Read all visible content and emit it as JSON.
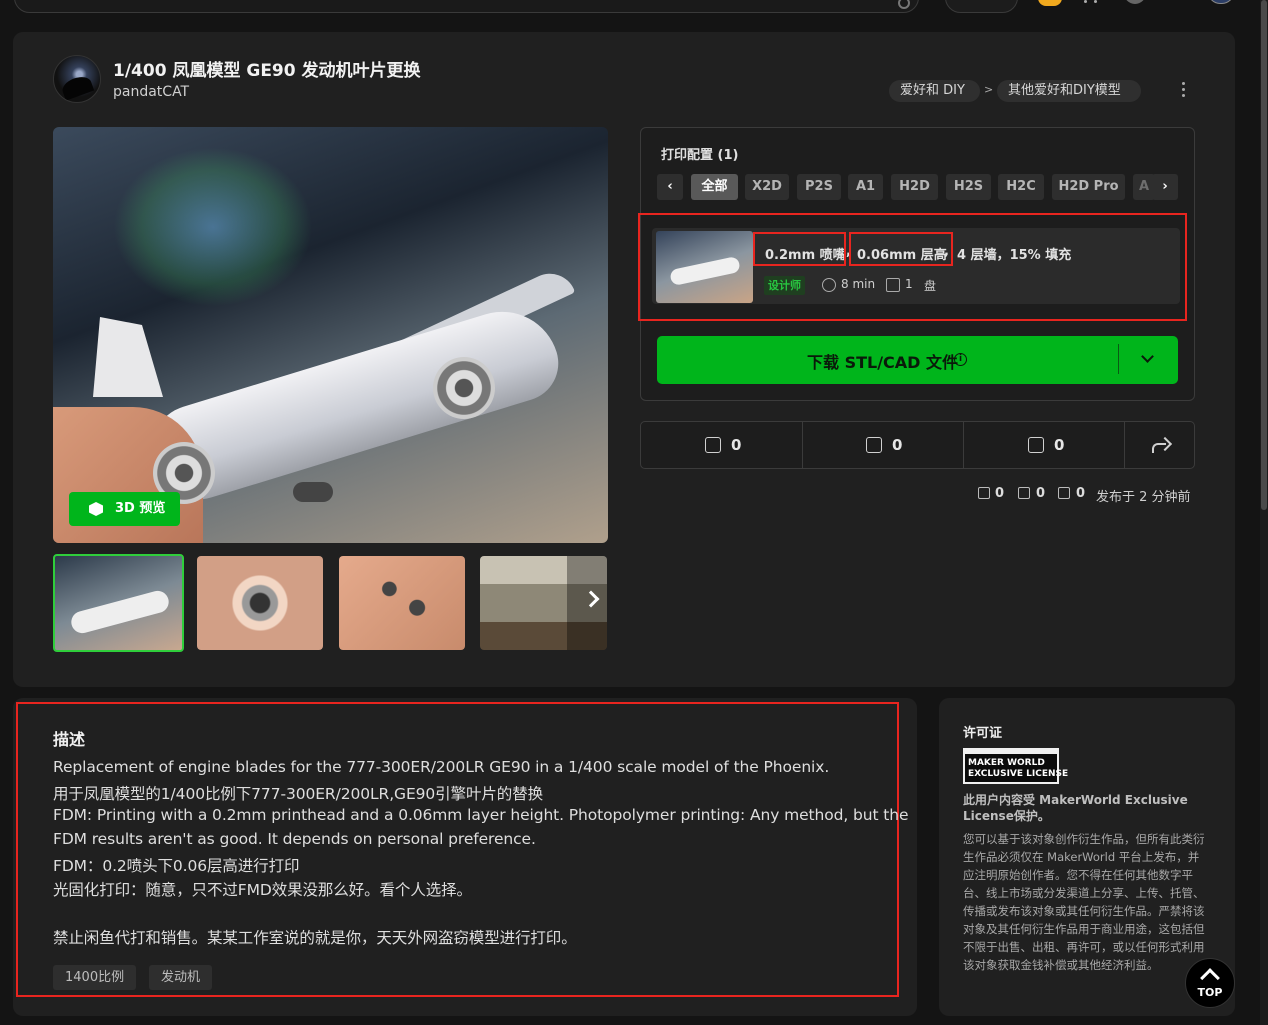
{
  "page": {
    "title": "1/400 凤凰模型 GE90 发动机叶片更换",
    "author": "pandatCAT",
    "breadcrumb": [
      "爱好和 DIY",
      "其他爱好和DIY模型"
    ],
    "breadcrumb_sep": ">"
  },
  "hero": {
    "btn_3d": "3D 预览"
  },
  "print_config": {
    "title": "打印配置 (1)",
    "printers": [
      "全部",
      "X2D",
      "P2S",
      "A1",
      "H2D",
      "H2S",
      "H2C",
      "H2D Pro",
      "A"
    ],
    "active_printer": "全部",
    "profile": {
      "nozzle": "0.2mm 喷嘴",
      "layer": "0.06mm 层高",
      "rest": "4 层墙，15% 填充",
      "comma": ",",
      "designer_tag": "设计师",
      "time": "8 min",
      "plates": "1",
      "plate_unit": "盘"
    },
    "download": {
      "label": "下载 STL/CAD 文件",
      "info_glyph": "i"
    }
  },
  "actions": {
    "likes": "0",
    "collects": "0",
    "comments": "0"
  },
  "stats": {
    "boosts": "0",
    "downloads": "0",
    "prints": "0",
    "published": "发布于 2 分钟前"
  },
  "description": {
    "heading": "描述",
    "lines": [
      "Replacement of engine blades for the 777-300ER/200LR GE90 in a 1/400 scale model of the Phoenix.",
      "用于凤凰模型的1/400比例下777-300ER/200LR,GE90引擎叶片的替换",
      "FDM: Printing with a 0.2mm printhead and a 0.06mm layer height. Photopolymer printing: Any method, but the",
      "FDM results aren't as good. It depends on personal preference.",
      "FDM：0.2喷头下0.06层高进行打印",
      "光固化打印：随意，只不过FMD效果没那么好。看个人选择。",
      "禁止闲鱼代打和销售。某某工作室说的就是你，天天外网盗窃模型进行打印。"
    ],
    "tags": [
      "1400比例",
      "发动机"
    ]
  },
  "license": {
    "heading": "许可证",
    "badge_line1": "MAKER WORLD",
    "badge_line2": "EXCLUSIVE LICENSE",
    "subtitle": "此用户内容受 MakerWorld Exclusive License保护。",
    "body": "您可以基于该对象创作衍生作品，但所有此类衍生作品必须仅在 MakerWorld 平台上发布，并应注明原始创作者。您不得在任何其他数字平台、线上市场或分发渠道上分享、上传、托管、传播或发布该对象或其任何衍生作品。严禁将该对象及其任何衍生作品用于商业用途，这包括但不限于出售、出租、再许可，或以任何形式利用该对象获取金钱补偿或其他经济利益。"
  },
  "to_top": "TOP"
}
